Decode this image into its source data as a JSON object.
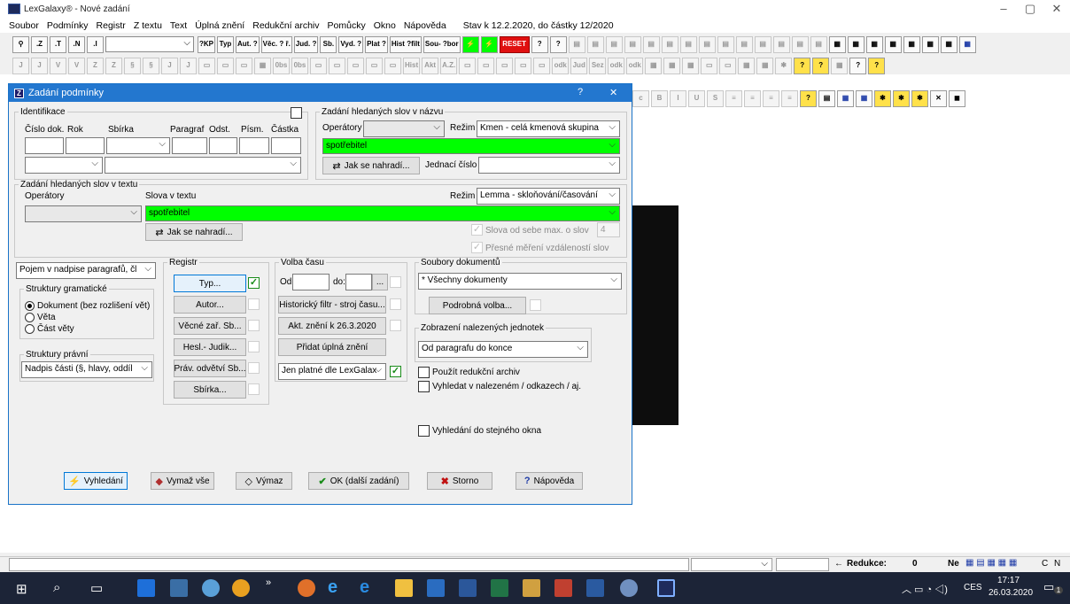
{
  "app": {
    "title": "LexGalaxy® - Nové zadání",
    "menu": [
      "Soubor",
      "Podmínky",
      "Registr",
      "Z textu",
      "Text",
      "Úplná znění",
      "Redukční archiv",
      "Pomůcky",
      "Okno",
      "Nápověda"
    ],
    "stav": "Stav k 12.2.2020, do částky 12/2020"
  },
  "toolbar1": {
    "buttons_a": [
      ".Z",
      ".T",
      ".N",
      ".I"
    ],
    "buttons_b": [
      "?KP",
      "Typ",
      "Aut. ?",
      "Věc. ? ř.",
      "Jud. ?",
      "Sb.",
      "Vyd. ?",
      "Plat ?",
      "Hist ?filt",
      "Sou- ?bor"
    ],
    "reset": "RESET"
  },
  "toolbar2": {
    "letters": [
      "J",
      "J",
      "V",
      "V",
      "Z",
      "Z",
      "§",
      "§",
      "J",
      "J"
    ],
    "texts": [
      "0bs",
      "0bs",
      "Hist",
      "Akt",
      "A.Z.",
      "odk",
      "Jud",
      "Sez",
      "odk",
      "odk"
    ]
  },
  "toolbar3": {
    "buttons": [
      "B",
      "I",
      "U",
      "S"
    ]
  },
  "dialog": {
    "title": "Zadání podmínky",
    "help": "?",
    "close": "✕",
    "identifikace": {
      "legend": "Identifikace",
      "labels": [
        "Číslo dok.",
        "Rok",
        "Sbírka",
        "Paragraf",
        "Odst.",
        "Písm.",
        "Částka"
      ]
    },
    "nazev": {
      "legend": "Zadání hledaných slov v názvu",
      "operatory_label": "Operátory",
      "rezim_label": "Režim",
      "rezim_value": "Kmen - celá kmenová skupina",
      "search_value": "spotřebitel",
      "jak_button": "Jak se nahradí...",
      "jednaci_label": "Jednací číslo"
    },
    "text": {
      "legend": "Zadání hledaných slov v textu",
      "operatory_label": "Operátory",
      "slova_label": "Slova v textu",
      "rezim_label": "Režim",
      "rezim_value": "Lemma - skloňování/časování",
      "search_value": "spotřebitel",
      "jak_button": "Jak se nahradí...",
      "slova_od_sebe": "Slova od sebe max. o slov",
      "slova_count": "4",
      "presne": "Přesné měření vzdáleností slov"
    },
    "left": {
      "pojem": "Pojem v nadpise paragrafů, čl",
      "struktury_gram": "Struktury gramatické",
      "radio": [
        "Dokument (bez rozlišení vět)",
        "Věta",
        "Část věty"
      ],
      "struktury_pravni": "Struktury právní",
      "nadpis": "Nadpis části (§, hlavy, oddíl"
    },
    "registr": {
      "legend": "Registr",
      "buttons": [
        "Typ...",
        "Autor...",
        "Věcné zař. Sb...",
        "Hesl.- Judik...",
        "Práv. odvětví Sb...",
        "Sbírka..."
      ]
    },
    "volba": {
      "legend": "Volba času",
      "od": "Od:",
      "do": "do:",
      "dots": "...",
      "buttons": [
        "Historický filtr - stroj času...",
        "Akt. znění k 26.3.2020",
        "Přidat úplná znění"
      ],
      "jen_platne": "Jen platné dle LexGalax"
    },
    "soubory": {
      "legend": "Soubory dokumentů",
      "value": "* Všechny dokumenty",
      "podrobna": "Podrobná volba...",
      "zobrazeni_legend": "Zobrazení nalezených jednotek",
      "zobrazeni_value": "Od paragrafu do konce",
      "redukcni": "Použít redukční archiv",
      "vyhledat_nalezenem": "Vyhledat v nalezeném / odkazech / aj.",
      "stejne_okno": "Vyhledání do stejného okna"
    },
    "footer": [
      "Vyhledání",
      "Vymaž vše",
      "Výmaz",
      "OK (další zadání)",
      "Storno",
      "Nápověda"
    ]
  },
  "statusbar": {
    "redukce_label": "Redukce:",
    "redukce_value": "0",
    "ne": "Ne",
    "c": "C",
    "n": "N"
  },
  "taskbar": {
    "lang": "CES",
    "time": "17:17",
    "date": "26.03.2020",
    "notif": "1"
  }
}
